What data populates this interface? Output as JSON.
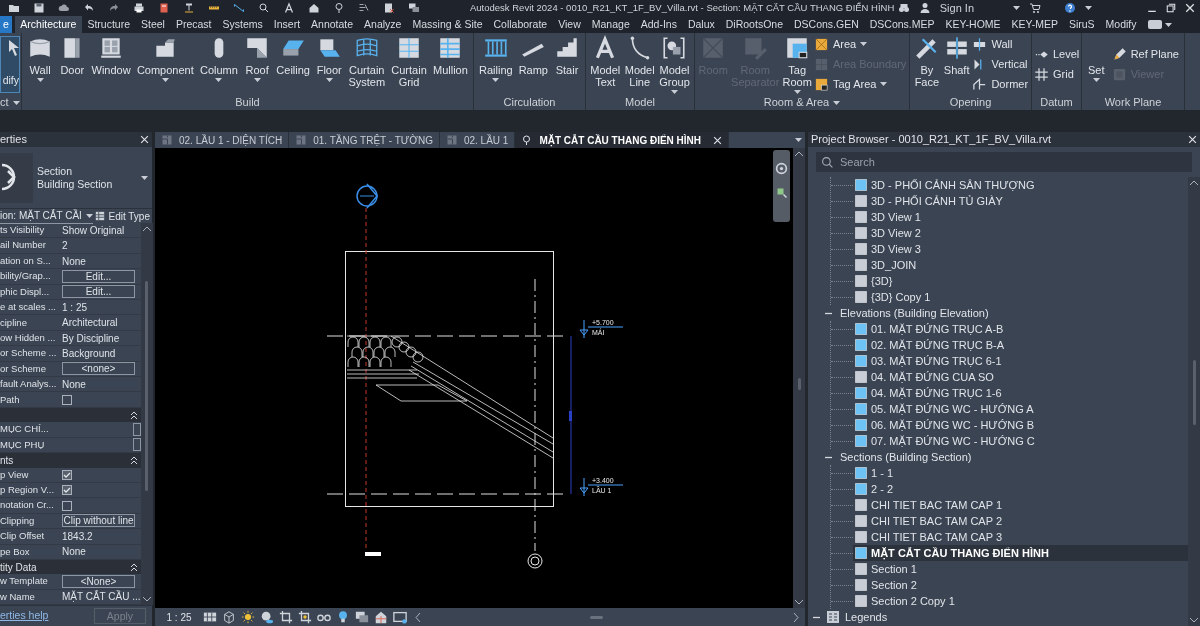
{
  "title_bar": {
    "title": "Autodesk Revit 2024 - 0010_R21_KT_1F_BV_Villa.rvt - Section: MẶT CẮT CẦU THANG ĐIỂN HÌNH",
    "sign_in": "Sign In"
  },
  "ribbon": {
    "file_tab": "e",
    "tabs": [
      {
        "label": "Architecture",
        "selected": true
      },
      {
        "label": "Structure",
        "selected": false
      },
      {
        "label": "Steel",
        "selected": false
      },
      {
        "label": "Precast",
        "selected": false
      },
      {
        "label": "Systems",
        "selected": false
      },
      {
        "label": "Insert",
        "selected": false
      },
      {
        "label": "Annotate",
        "selected": false
      },
      {
        "label": "Analyze",
        "selected": false
      },
      {
        "label": "Massing & Site",
        "selected": false
      },
      {
        "label": "Collaborate",
        "selected": false
      },
      {
        "label": "View",
        "selected": false
      },
      {
        "label": "Manage",
        "selected": false
      },
      {
        "label": "Add-Ins",
        "selected": false
      },
      {
        "label": "Dalux",
        "selected": false
      },
      {
        "label": "DiRootsOne",
        "selected": false
      },
      {
        "label": "DSCons.GEN",
        "selected": false
      },
      {
        "label": "DSCons.MEP",
        "selected": false
      },
      {
        "label": "KEY-HOME",
        "selected": false
      },
      {
        "label": "KEY-MEP",
        "selected": false
      },
      {
        "label": "SiruS",
        "selected": false
      },
      {
        "label": "Modify",
        "selected": false
      }
    ],
    "select_panel": {
      "button": "dify",
      "label": "ct"
    },
    "panels": [
      {
        "label": "Build",
        "dropdown": false,
        "tools": [
          {
            "label": "Wall",
            "kind": "large",
            "dropdown": true,
            "disabled": false
          },
          {
            "label": "Door",
            "kind": "large",
            "dropdown": false,
            "disabled": false
          },
          {
            "label": "Window",
            "kind": "large",
            "dropdown": false,
            "disabled": false
          },
          {
            "label": "Component",
            "kind": "large",
            "dropdown": true,
            "disabled": false
          },
          {
            "label": "Column",
            "kind": "large",
            "dropdown": true,
            "disabled": false
          },
          {
            "label": "Roof",
            "kind": "large",
            "dropdown": true,
            "disabled": false
          },
          {
            "label": "Ceiling",
            "kind": "large",
            "dropdown": false,
            "disabled": false
          },
          {
            "label": "Floor",
            "kind": "large",
            "dropdown": true,
            "disabled": false
          },
          {
            "label": "Curtain System",
            "kind": "large",
            "dropdown": false,
            "disabled": false
          },
          {
            "label": "Curtain Grid",
            "kind": "large",
            "dropdown": false,
            "disabled": false
          },
          {
            "label": "Mullion",
            "kind": "large",
            "dropdown": false,
            "disabled": false
          }
        ]
      },
      {
        "label": "Circulation",
        "dropdown": false,
        "tools": [
          {
            "label": "Railing",
            "kind": "large",
            "dropdown": true,
            "disabled": false
          },
          {
            "label": "Ramp",
            "kind": "large",
            "dropdown": false,
            "disabled": false
          },
          {
            "label": "Stair",
            "kind": "large",
            "dropdown": false,
            "disabled": false
          }
        ]
      },
      {
        "label": "Model",
        "dropdown": false,
        "tools": [
          {
            "label": "Model Text",
            "kind": "large",
            "dropdown": false,
            "disabled": false
          },
          {
            "label": "Model Line",
            "kind": "large",
            "dropdown": false,
            "disabled": false
          },
          {
            "label": "Model Group",
            "kind": "large",
            "dropdown": true,
            "disabled": false
          }
        ]
      },
      {
        "label": "Room & Area",
        "dropdown": true,
        "tools": [
          {
            "label": "Room",
            "kind": "large",
            "dropdown": false,
            "disabled": true
          },
          {
            "label": "Room Separator",
            "kind": "large",
            "dropdown": false,
            "disabled": true
          },
          {
            "label": "Tag Room",
            "kind": "large",
            "dropdown": true,
            "disabled": false
          },
          {
            "label": "Area",
            "kind": "small",
            "dropdown": true,
            "disabled": false
          },
          {
            "label": "Area Boundary",
            "kind": "small",
            "dropdown": false,
            "disabled": true
          },
          {
            "label": "Tag Area",
            "kind": "small",
            "dropdown": true,
            "disabled": false
          }
        ]
      },
      {
        "label": "Opening",
        "dropdown": false,
        "tools": [
          {
            "label": "By Face",
            "kind": "large",
            "dropdown": false,
            "disabled": false
          },
          {
            "label": "Shaft",
            "kind": "large",
            "dropdown": false,
            "disabled": false
          },
          {
            "label": "Wall",
            "kind": "small",
            "dropdown": false,
            "disabled": false
          },
          {
            "label": "Vertical",
            "kind": "small",
            "dropdown": false,
            "disabled": false
          },
          {
            "label": "Dormer",
            "kind": "small",
            "dropdown": false,
            "disabled": false
          }
        ]
      },
      {
        "label": "Datum",
        "dropdown": false,
        "tools": [
          {
            "label": "Level",
            "kind": "small",
            "dropdown": false,
            "disabled": false
          },
          {
            "label": "Grid",
            "kind": "small",
            "dropdown": false,
            "disabled": false
          }
        ]
      },
      {
        "label": "Work Plane",
        "dropdown": false,
        "tools": [
          {
            "label": "Set",
            "kind": "large",
            "dropdown": true,
            "disabled": false
          },
          {
            "label": "Ref Plane",
            "kind": "small",
            "dropdown": false,
            "disabled": false
          },
          {
            "label": "Viewer",
            "kind": "small",
            "dropdown": false,
            "disabled": true
          }
        ]
      }
    ]
  },
  "properties": {
    "title": "erties",
    "type": {
      "name": "Section",
      "subtype": "Building Section"
    },
    "instance": "ion: MẶT CẮT CẦI",
    "edit_type": "Edit Type",
    "rows": [
      {
        "kind": "value",
        "label": "ts Visibility",
        "value": "Show Original"
      },
      {
        "kind": "value",
        "label": "ail Number",
        "value": "2"
      },
      {
        "kind": "value",
        "label": "ation on S...",
        "value": "None"
      },
      {
        "kind": "button",
        "label": "bility/Grap...",
        "value": "Edit..."
      },
      {
        "kind": "button",
        "label": "phic Displ...",
        "value": "Edit..."
      },
      {
        "kind": "value",
        "label": "e at scales ...",
        "value": "1 : 25"
      },
      {
        "kind": "value",
        "label": "cipline",
        "value": "Architectural"
      },
      {
        "kind": "value",
        "label": "ow Hidden ...",
        "value": "By Discipline"
      },
      {
        "kind": "value",
        "label": "or Scheme ...",
        "value": "Background"
      },
      {
        "kind": "button",
        "label": "or Scheme",
        "value": "<none>"
      },
      {
        "kind": "value",
        "label": "fault Analys...",
        "value": "None"
      },
      {
        "kind": "checkbox",
        "label": "Path",
        "checked": false
      },
      {
        "kind": "group",
        "expanded": true
      },
      {
        "kind": "field",
        "label": "MỤC CHÍ..."
      },
      {
        "kind": "field",
        "label": "MỤC PHỤ"
      },
      {
        "kind": "group",
        "label": "nts",
        "expanded": true
      },
      {
        "kind": "checkbox",
        "label": "p View",
        "checked": true
      },
      {
        "kind": "checkbox",
        "label": "p Region V...",
        "checked": true
      },
      {
        "kind": "checkbox",
        "label": "notation Cr...",
        "checked": false
      },
      {
        "kind": "button",
        "label": "Clipping",
        "value": "Clip without line"
      },
      {
        "kind": "value",
        "label": "Clip Offset",
        "value": "1843.2"
      },
      {
        "kind": "value",
        "label": "pe Box",
        "value": "None"
      },
      {
        "kind": "group",
        "label": "tity Data",
        "expanded": true
      },
      {
        "kind": "button",
        "label": "w Template",
        "value": "<None>"
      },
      {
        "kind": "value",
        "label": "w Name",
        "value": "MẶT CẮT CẦU ..."
      }
    ],
    "help_link": "erties help",
    "apply": {
      "label": "Apply",
      "disabled": true
    }
  },
  "view": {
    "tabs": [
      {
        "label": "02. LẦU 1 - DIỆN TÍCH",
        "kind": "plan",
        "selected": false
      },
      {
        "label": "01. TẦNG TRỆT - TƯỜNG",
        "kind": "plan",
        "selected": false
      },
      {
        "label": "02. LẦU 1",
        "kind": "plan",
        "selected": false
      },
      {
        "label": "MẶT CẮT CẦU THANG ĐIỂN HÌNH",
        "kind": "section",
        "selected": true
      }
    ],
    "levels": [
      {
        "elevation": "+5.700",
        "name": "MÁI"
      },
      {
        "elevation": "+3.400",
        "name": "LẦU 1"
      }
    ],
    "scale": "1 : 25"
  },
  "project_browser": {
    "title": "Project Browser - 0010_R21_KT_1F_BV_Villa.rvt",
    "search": {
      "placeholder": "Search"
    },
    "continued": [
      {
        "label": "3D - PHỐI CẢNH SÂN THƯỢNG",
        "placed": true,
        "selected": false
      },
      {
        "label": "3D - PHỐI CẢNH TỦ GIÀY",
        "placed": false,
        "selected": false
      },
      {
        "label": "3D View 1",
        "placed": false,
        "selected": false
      },
      {
        "label": "3D View 2",
        "placed": false,
        "selected": false
      },
      {
        "label": "3D View 3",
        "placed": false,
        "selected": false
      },
      {
        "label": "3D_JOIN",
        "placed": false,
        "selected": false
      },
      {
        "label": "{3D}",
        "placed": false,
        "selected": false
      },
      {
        "label": "{3D} Copy 1",
        "placed": false,
        "selected": false
      }
    ],
    "groups": [
      {
        "label": "Elevations (Building Elevation)",
        "expanded": true,
        "children": [
          {
            "label": "01. MẶT ĐỨNG TRỤC A-B",
            "placed": true,
            "selected": false
          },
          {
            "label": "02. MẶT ĐỨNG TRỤC B-A",
            "placed": true,
            "selected": false
          },
          {
            "label": "03. MẶT ĐỨNG TRỤC 6-1",
            "placed": true,
            "selected": false
          },
          {
            "label": "04. MẶT ĐỨNG CUA SO",
            "placed": false,
            "selected": false
          },
          {
            "label": "04. MẶT ĐỨNG TRỤC 1-6",
            "placed": true,
            "selected": false
          },
          {
            "label": "05. MẶT ĐỨNG WC - HƯỚNG A",
            "placed": true,
            "selected": false
          },
          {
            "label": "06. MẶT ĐỨNG WC - HƯỚNG B",
            "placed": true,
            "selected": false
          },
          {
            "label": "07. MẶT ĐỨNG WC - HƯỚNG C",
            "placed": true,
            "selected": false
          }
        ]
      },
      {
        "label": "Sections (Building Section)",
        "expanded": true,
        "children": [
          {
            "label": "1 - 1",
            "placed": true,
            "selected": false
          },
          {
            "label": "2 - 2",
            "placed": true,
            "selected": false
          },
          {
            "label": "CHI TIET BAC TAM CAP 1",
            "placed": false,
            "selected": false
          },
          {
            "label": "CHI TIET BAC TAM CAP 2",
            "placed": false,
            "selected": false
          },
          {
            "label": "CHI TIET BAC TAM CAP 3",
            "placed": false,
            "selected": false
          },
          {
            "label": "MẶT CẮT CẦU THANG ĐIỂN HÌNH",
            "placed": true,
            "selected": true
          },
          {
            "label": "Section 1",
            "placed": false,
            "selected": false
          },
          {
            "label": "Section 2",
            "placed": false,
            "selected": false
          },
          {
            "label": "Section 2 Copy 1",
            "placed": false,
            "selected": false
          }
        ]
      }
    ],
    "roots": [
      {
        "label": "Legends",
        "expanded": true
      }
    ]
  }
}
